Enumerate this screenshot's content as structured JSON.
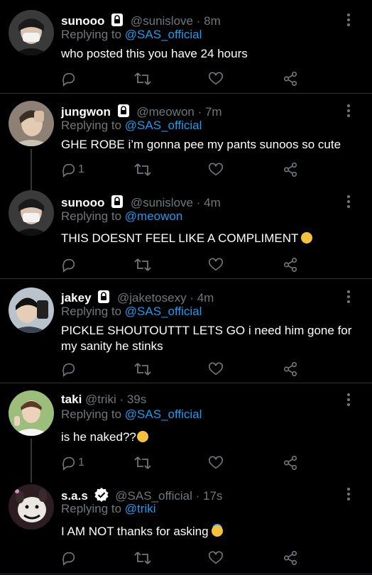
{
  "tweets": [
    {
      "name": "sunooo",
      "handle": "@sunislove",
      "time": "· 8m",
      "replying_label": "Replying to",
      "replying_to": "@SAS_official",
      "text": "who posted this you have 24 hours",
      "reply_count": "",
      "locked": true
    },
    {
      "name": "jungwon",
      "handle": "@meowon",
      "time": "· 7m",
      "replying_label": "Replying to",
      "replying_to": "@SAS_official",
      "text": "GHE ROBE i’m gonna pee my pants sunoos so cute",
      "reply_count": "1",
      "locked": true
    },
    {
      "name": "sunooo",
      "handle": "@sunislove",
      "time": "· 4m",
      "replying_label": "Replying to",
      "replying_to": "@meowon",
      "text": "THIS DOESNT FEEL LIKE A COMPLIMENT",
      "reply_count": "",
      "locked": true
    },
    {
      "name": "jakey",
      "handle": "@jaketosexy",
      "time": "· 4m",
      "replying_label": "Replying to",
      "replying_to": "@SAS_official",
      "text": "PICKLE SHOUTOUTTT LETS GO i need him gone for my sanity he stinks",
      "reply_count": "",
      "locked": true
    },
    {
      "name": "taki",
      "handle": "@triki",
      "time": "· 39s",
      "replying_label": "Replying to",
      "replying_to": "@SAS_official",
      "text": "is he naked??",
      "reply_count": "1",
      "locked": false
    },
    {
      "name": "s.a.s",
      "handle": "@SAS_official",
      "time": "· 17s",
      "replying_label": "Replying to",
      "replying_to": "@triki",
      "text": "I AM NOT thanks for asking",
      "reply_count": "",
      "locked": false,
      "verified": true
    }
  ],
  "icons": {
    "reply": "reply-icon",
    "retweet": "retweet-icon",
    "like": "heart-icon",
    "share": "share-icon",
    "more": "more-icon",
    "lock": "lock-icon",
    "verified": "verified-icon"
  },
  "colors": {
    "background": "#000000",
    "link": "#1d9bf0",
    "secondary_text": "#71767b",
    "divider": "#2f3336"
  }
}
